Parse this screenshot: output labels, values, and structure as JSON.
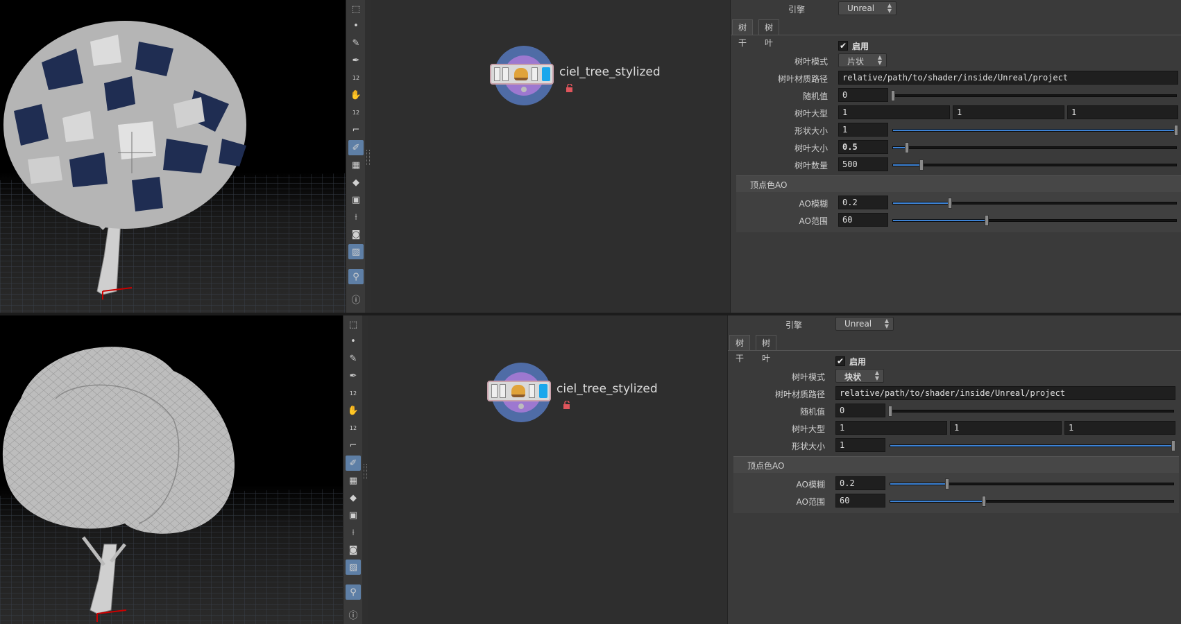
{
  "node_name": "ciel_tree_stylized",
  "tools": [
    "select-icon",
    "point-icon",
    "brush-icon",
    "pen-icon",
    "number-icon",
    "hand-icon",
    "number-tool-icon",
    "measure-icon",
    "paint-icon",
    "checker-icon",
    "diamond-icon",
    "image-icon",
    "split-icon",
    "stop-icon",
    "view-icon",
    "pin-icon",
    "info-icon"
  ],
  "panels": [
    {
      "engine_label": "引擎",
      "engine_value": "Unreal",
      "tabs": [
        "树干",
        "树叶"
      ],
      "enable_label": "启用",
      "leaf_mode_label": "树叶模式",
      "leaf_mode_value": "片状",
      "material_label": "树叶材质路径",
      "material_value": "relative/path/to/shader/inside/Unreal/project",
      "seed_label": "随机值",
      "seed_value": "0",
      "seed_level": 0,
      "leaf_scale_label": "树叶大型",
      "leaf_scale_values": [
        "1",
        "1",
        "1"
      ],
      "shape_size_label": "形状大小",
      "shape_size_value": "1",
      "shape_size_level": 1.0,
      "leaf_size_label": "树叶大小",
      "leaf_size_value": "0.5",
      "leaf_size_level": 0.05,
      "leaf_count_label": "树叶数量",
      "leaf_count_value": "500",
      "leaf_count_level": 0.1,
      "folder_label": "顶点色AO",
      "ao_blur_label": "AO模糊",
      "ao_blur_value": "0.2",
      "ao_blur_level": 0.2,
      "ao_range_label": "AO范围",
      "ao_range_value": "60",
      "ao_range_level": 0.33
    },
    {
      "engine_label": "引擎",
      "engine_value": "Unreal",
      "tabs": [
        "树干",
        "树叶"
      ],
      "enable_label": "启用",
      "leaf_mode_label": "树叶模式",
      "leaf_mode_value": "块状",
      "material_label": "树叶材质路径",
      "material_value": "relative/path/to/shader/inside/Unreal/project",
      "seed_label": "随机值",
      "seed_value": "0",
      "seed_level": 0,
      "leaf_scale_label": "树叶大型",
      "leaf_scale_values": [
        "1",
        "1",
        "1"
      ],
      "shape_size_label": "形状大小",
      "shape_size_value": "1",
      "shape_size_level": 1.0,
      "folder_label": "顶点色AO",
      "ao_blur_label": "AO模糊",
      "ao_blur_value": "0.2",
      "ao_blur_level": 0.2,
      "ao_range_label": "AO范围",
      "ao_range_value": "60",
      "ao_range_level": 0.33
    }
  ]
}
